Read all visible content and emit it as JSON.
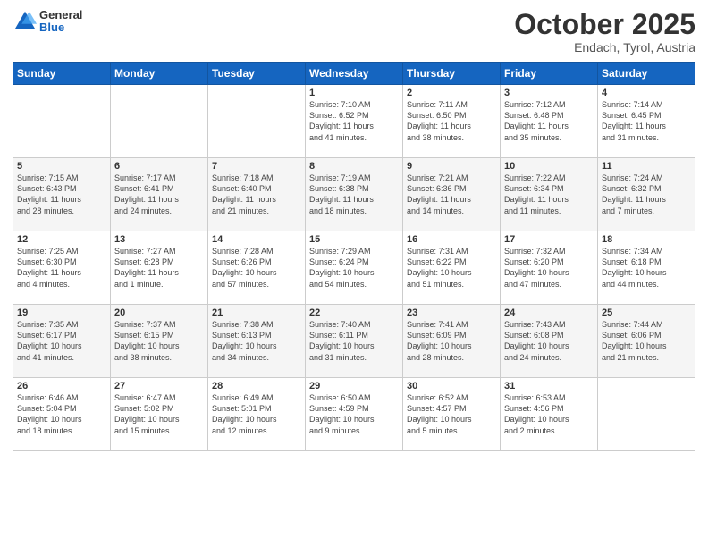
{
  "header": {
    "logo_general": "General",
    "logo_blue": "Blue",
    "month_title": "October 2025",
    "location": "Endach, Tyrol, Austria"
  },
  "days_of_week": [
    "Sunday",
    "Monday",
    "Tuesday",
    "Wednesday",
    "Thursday",
    "Friday",
    "Saturday"
  ],
  "weeks": [
    [
      {
        "day": "",
        "info": ""
      },
      {
        "day": "",
        "info": ""
      },
      {
        "day": "",
        "info": ""
      },
      {
        "day": "1",
        "info": "Sunrise: 7:10 AM\nSunset: 6:52 PM\nDaylight: 11 hours\nand 41 minutes."
      },
      {
        "day": "2",
        "info": "Sunrise: 7:11 AM\nSunset: 6:50 PM\nDaylight: 11 hours\nand 38 minutes."
      },
      {
        "day": "3",
        "info": "Sunrise: 7:12 AM\nSunset: 6:48 PM\nDaylight: 11 hours\nand 35 minutes."
      },
      {
        "day": "4",
        "info": "Sunrise: 7:14 AM\nSunset: 6:45 PM\nDaylight: 11 hours\nand 31 minutes."
      }
    ],
    [
      {
        "day": "5",
        "info": "Sunrise: 7:15 AM\nSunset: 6:43 PM\nDaylight: 11 hours\nand 28 minutes."
      },
      {
        "day": "6",
        "info": "Sunrise: 7:17 AM\nSunset: 6:41 PM\nDaylight: 11 hours\nand 24 minutes."
      },
      {
        "day": "7",
        "info": "Sunrise: 7:18 AM\nSunset: 6:40 PM\nDaylight: 11 hours\nand 21 minutes."
      },
      {
        "day": "8",
        "info": "Sunrise: 7:19 AM\nSunset: 6:38 PM\nDaylight: 11 hours\nand 18 minutes."
      },
      {
        "day": "9",
        "info": "Sunrise: 7:21 AM\nSunset: 6:36 PM\nDaylight: 11 hours\nand 14 minutes."
      },
      {
        "day": "10",
        "info": "Sunrise: 7:22 AM\nSunset: 6:34 PM\nDaylight: 11 hours\nand 11 minutes."
      },
      {
        "day": "11",
        "info": "Sunrise: 7:24 AM\nSunset: 6:32 PM\nDaylight: 11 hours\nand 7 minutes."
      }
    ],
    [
      {
        "day": "12",
        "info": "Sunrise: 7:25 AM\nSunset: 6:30 PM\nDaylight: 11 hours\nand 4 minutes."
      },
      {
        "day": "13",
        "info": "Sunrise: 7:27 AM\nSunset: 6:28 PM\nDaylight: 11 hours\nand 1 minute."
      },
      {
        "day": "14",
        "info": "Sunrise: 7:28 AM\nSunset: 6:26 PM\nDaylight: 10 hours\nand 57 minutes."
      },
      {
        "day": "15",
        "info": "Sunrise: 7:29 AM\nSunset: 6:24 PM\nDaylight: 10 hours\nand 54 minutes."
      },
      {
        "day": "16",
        "info": "Sunrise: 7:31 AM\nSunset: 6:22 PM\nDaylight: 10 hours\nand 51 minutes."
      },
      {
        "day": "17",
        "info": "Sunrise: 7:32 AM\nSunset: 6:20 PM\nDaylight: 10 hours\nand 47 minutes."
      },
      {
        "day": "18",
        "info": "Sunrise: 7:34 AM\nSunset: 6:18 PM\nDaylight: 10 hours\nand 44 minutes."
      }
    ],
    [
      {
        "day": "19",
        "info": "Sunrise: 7:35 AM\nSunset: 6:17 PM\nDaylight: 10 hours\nand 41 minutes."
      },
      {
        "day": "20",
        "info": "Sunrise: 7:37 AM\nSunset: 6:15 PM\nDaylight: 10 hours\nand 38 minutes."
      },
      {
        "day": "21",
        "info": "Sunrise: 7:38 AM\nSunset: 6:13 PM\nDaylight: 10 hours\nand 34 minutes."
      },
      {
        "day": "22",
        "info": "Sunrise: 7:40 AM\nSunset: 6:11 PM\nDaylight: 10 hours\nand 31 minutes."
      },
      {
        "day": "23",
        "info": "Sunrise: 7:41 AM\nSunset: 6:09 PM\nDaylight: 10 hours\nand 28 minutes."
      },
      {
        "day": "24",
        "info": "Sunrise: 7:43 AM\nSunset: 6:08 PM\nDaylight: 10 hours\nand 24 minutes."
      },
      {
        "day": "25",
        "info": "Sunrise: 7:44 AM\nSunset: 6:06 PM\nDaylight: 10 hours\nand 21 minutes."
      }
    ],
    [
      {
        "day": "26",
        "info": "Sunrise: 6:46 AM\nSunset: 5:04 PM\nDaylight: 10 hours\nand 18 minutes."
      },
      {
        "day": "27",
        "info": "Sunrise: 6:47 AM\nSunset: 5:02 PM\nDaylight: 10 hours\nand 15 minutes."
      },
      {
        "day": "28",
        "info": "Sunrise: 6:49 AM\nSunset: 5:01 PM\nDaylight: 10 hours\nand 12 minutes."
      },
      {
        "day": "29",
        "info": "Sunrise: 6:50 AM\nSunset: 4:59 PM\nDaylight: 10 hours\nand 9 minutes."
      },
      {
        "day": "30",
        "info": "Sunrise: 6:52 AM\nSunset: 4:57 PM\nDaylight: 10 hours\nand 5 minutes."
      },
      {
        "day": "31",
        "info": "Sunrise: 6:53 AM\nSunset: 4:56 PM\nDaylight: 10 hours\nand 2 minutes."
      },
      {
        "day": "",
        "info": ""
      }
    ]
  ]
}
